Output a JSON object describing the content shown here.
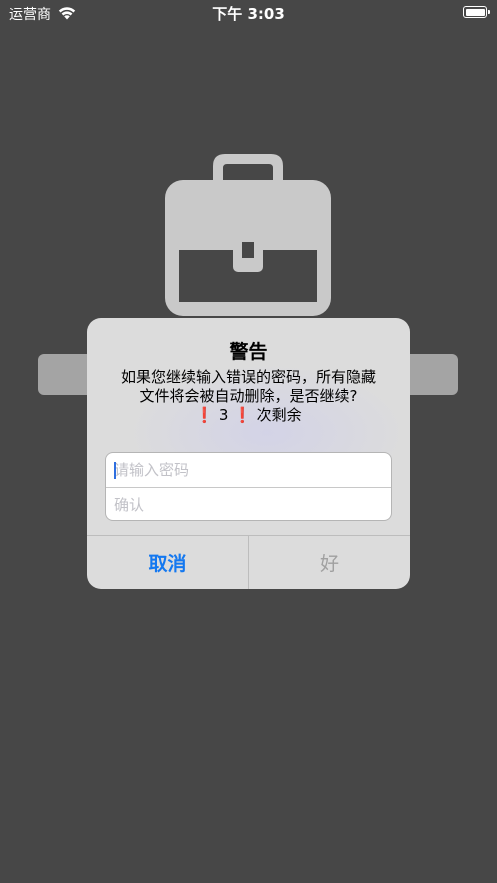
{
  "status_bar": {
    "carrier": "运营商",
    "time": "下午 3:03"
  },
  "alert": {
    "title": "警告",
    "message_line1": "如果您继续输入错误的密码，所有隐藏",
    "message_line2": "文件将会被自动删除，是否继续?",
    "attempts_mark": "❗",
    "attempts_count": "3",
    "attempts_suffix": "次剩余",
    "password_placeholder": "请输入密码",
    "confirm_placeholder": "确认",
    "cancel_label": "取消",
    "ok_label": "好"
  },
  "colors": {
    "background": "#474747",
    "accent": "#1478f0",
    "disabled": "#a0a0a0",
    "warning": "#e0231c"
  }
}
